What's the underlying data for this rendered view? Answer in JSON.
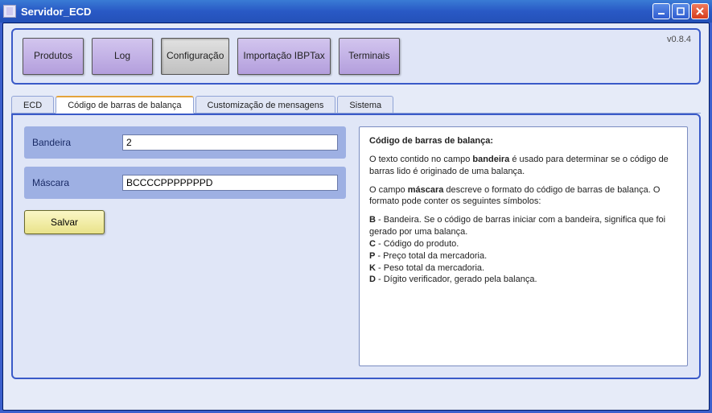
{
  "window": {
    "title": "Servidor_ECD"
  },
  "topPanel": {
    "version": "v0.8.4",
    "buttons": {
      "produtos": "Produtos",
      "log": "Log",
      "configuracao": "Configuração",
      "importacao": "Importação IBPTax",
      "terminais": "Terminais"
    },
    "activeIndex": 2
  },
  "tabs": {
    "items": [
      "ECD",
      "Código de barras de balança",
      "Customização de mensagens",
      "Sistema"
    ],
    "activeIndex": 1
  },
  "form": {
    "bandeira_label": "Bandeira",
    "bandeira_value": "2",
    "mascara_label": "Máscara",
    "mascara_value": "BCCCCPPPPPPPD",
    "save_label": "Salvar"
  },
  "help": {
    "title": "Código de barras de balança:",
    "p1_a": "O texto contido no campo ",
    "p1_b": "bandeira",
    "p1_c": " é usado para determinar se o código de barras lido é originado de uma balança.",
    "p2_a": "O campo ",
    "p2_b": "máscara",
    "p2_c": " descreve o formato do código de barras de balança. O formato pode conter os seguintes símbolos:",
    "legend": {
      "B": " - Bandeira. Se o código de barras iniciar com a bandeira, significa que foi gerado por uma balança.",
      "C": " - Código do produto.",
      "P": " - Preço total da mercadoria.",
      "K": " - Peso total da mercadoria.",
      "D": " - Dígito verificador, gerado pela balança."
    }
  }
}
